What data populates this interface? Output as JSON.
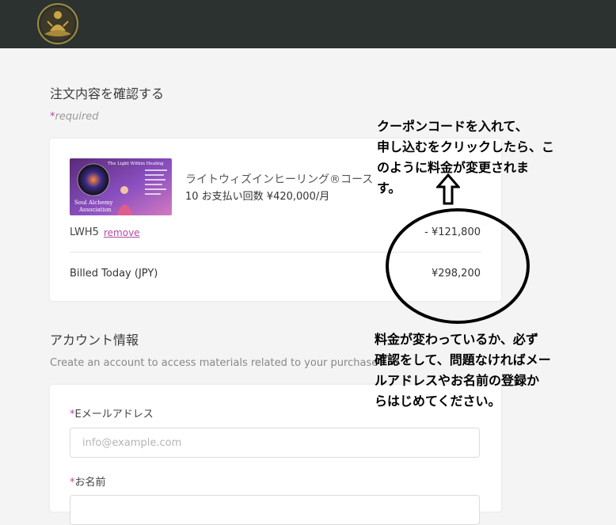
{
  "header": {
    "logo": "lotus-emblem-logo"
  },
  "order": {
    "title": "注文内容を確認する",
    "required_star": "*",
    "required_text": "required",
    "product": {
      "image_text_title": "The Light Within Healing",
      "image_text_brand_1": "Soul Alchemy",
      "image_text_brand_2": "Association",
      "name": "ライトウィズインヒーリング®コース",
      "detail": "10 お支払い回数 ¥420,000/月"
    },
    "coupon_code": "LWH5",
    "remove_label": "remove",
    "discount": "- ¥121,800",
    "billed_label": "Billed Today (JPY)",
    "billed_value": "¥298,200"
  },
  "account": {
    "title": "アカウント情報",
    "subtitle": "Create an account to access materials related to your purchase",
    "email_label_star": "*",
    "email_label": "Eメールアドレス",
    "email_placeholder": "info@example.com",
    "name_label_star": "*",
    "name_label": "お名前"
  },
  "annotations": {
    "top_lines": [
      "クーポンコードを入れて、",
      "申し込むをクリックしたら、こ",
      "のように料金が変更されま",
      "す。"
    ],
    "bottom_lines": [
      "料金が変わっているか、必ず",
      "確認をして、問題なければメー",
      "ルアドレスやお名前の登録か",
      "らはじめてください。"
    ]
  }
}
